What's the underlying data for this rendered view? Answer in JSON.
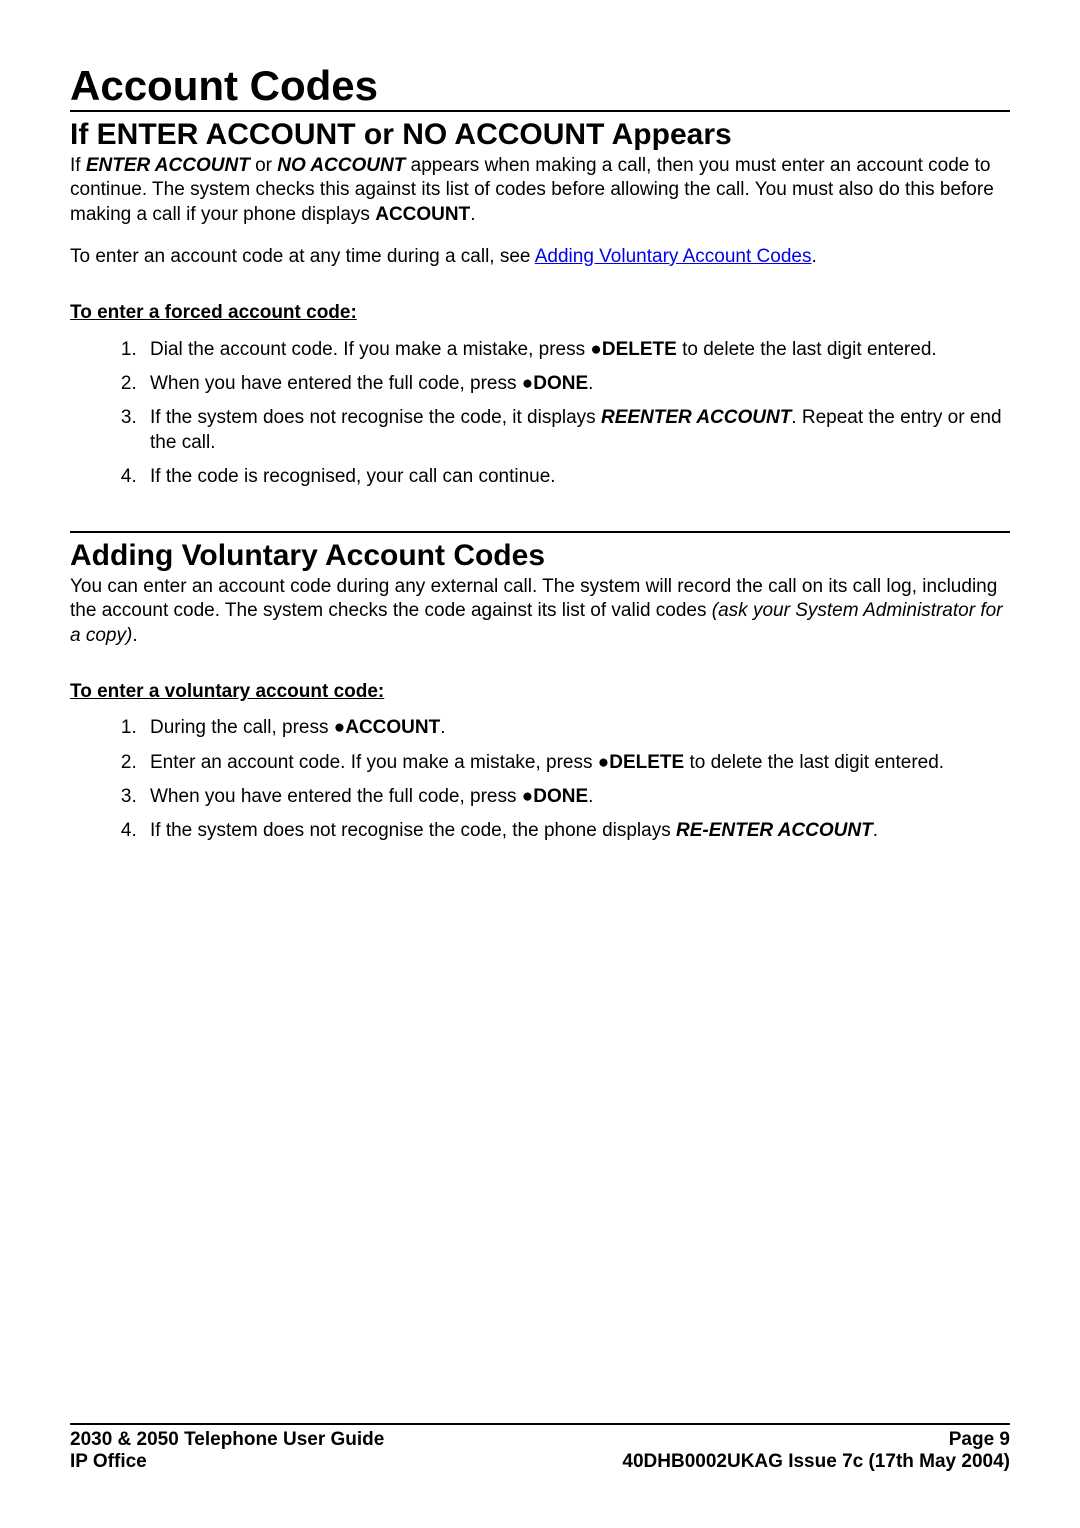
{
  "page": {
    "title": "Account Codes",
    "section1": {
      "heading": "If ENTER ACCOUNT or NO ACCOUNT Appears",
      "p1_a": "If ",
      "p1_b": "ENTER ACCOUNT",
      "p1_c": " or ",
      "p1_d": "NO ACCOUNT",
      "p1_e": " appears when making a call, then you must enter an account code to continue. The system checks this against its list of codes before allowing the call. You must also do this before making a call if your phone displays ",
      "p1_f": "ACCOUNT",
      "p1_g": ".",
      "p2_a": "To enter an account code at any time during a call, see ",
      "p2_link": "Adding Voluntary Account Codes",
      "p2_b": ".",
      "sub": "To enter a forced account code:",
      "li1_a": "Dial the account code. If you make a mistake, press ",
      "li1_b": "●DELETE",
      "li1_c": " to delete the last digit entered.",
      "li2_a": "When you have entered the full code, press ",
      "li2_b": "●DONE",
      "li2_c": ".",
      "li3_a": "If the system does not recognise the code, it displays ",
      "li3_b": "REENTER ACCOUNT",
      "li3_c": ". Repeat the entry or end the call.",
      "li4": "If the code is recognised, your call can continue."
    },
    "section2": {
      "heading": "Adding Voluntary Account Codes",
      "p1_a": "You can enter an account code during any external call. The system will record the call on its call log, including the account code. The system checks the code against its list of valid codes ",
      "p1_b": "(ask your System Administrator for a copy)",
      "p1_c": ".",
      "sub": "To enter a voluntary account code:",
      "li1_a": "During the call, press ",
      "li1_b": "●ACCOUNT",
      "li1_c": ".",
      "li2_a": "Enter an account code. If you make a mistake, press ",
      "li2_b": "●DELETE",
      "li2_c": " to delete the last digit entered.",
      "li3_a": "When you have entered the full code, press ",
      "li3_b": "●DONE",
      "li3_c": ".",
      "li4_a": "If the system does not recognise the code, the phone displays ",
      "li4_b": "RE-ENTER ACCOUNT",
      "li4_c": "."
    }
  },
  "footer": {
    "left1": "2030 & 2050 Telephone User Guide",
    "right1": "Page 9",
    "left2": "IP Office",
    "right2": "40DHB0002UKAG Issue 7c (17th May 2004)"
  }
}
